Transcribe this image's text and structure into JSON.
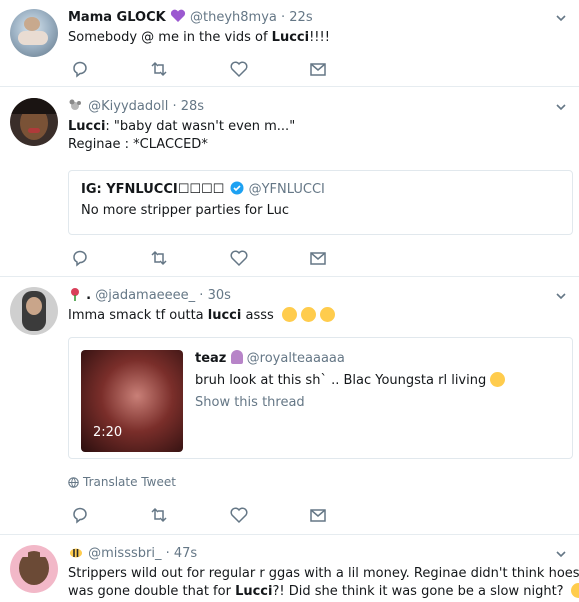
{
  "tweets": [
    {
      "name": "Mama GLOCK",
      "handle": "@theyh8mya",
      "time": "22s",
      "text_before": "Somebody @ me in the vids of ",
      "text_bold": "Lucci",
      "text_after": "!!!!"
    },
    {
      "handle": "@Kiyydadoll",
      "time": "28s",
      "line1_bold": "Lucci",
      "line1_rest": ": \"baby dat wasn't even m...\"",
      "line2": "Reginae : *CLACCED*",
      "quote": {
        "name": "IG: YFNLUCCI☐☐☐☐",
        "handle": "@YFNLUCCI",
        "text": "No more stripper parties for Luc"
      }
    },
    {
      "handle_prefix": ".",
      "handle": "@jadamaeeee_",
      "time": "30s",
      "text_before": "Imma smack tf outta ",
      "text_bold": "lucci",
      "text_after": " asss",
      "quote": {
        "name": "teaz",
        "handle": "@royalteaaaaa",
        "text": "bruh look at this sh` .. Blac Youngsta rl living",
        "show_thread": "Show this thread",
        "duration": "2:20"
      },
      "translate": "Translate Tweet"
    },
    {
      "handle": "@misssbri_",
      "time": "47s",
      "text1": "Strippers wild out for regular r  ggas with a lil money. Reginae didn't think hoes",
      "text2_before": "was gone double that for ",
      "text2_bold": "Lucci",
      "text2_after": "?! Did she think it was gone be a slow night?"
    }
  ],
  "colors": {
    "accent": "#1da1f2",
    "muted": "#657786",
    "purple_heart": "#9b59d0",
    "emoji_yellow": "#ffcc4d"
  },
  "icons": [
    "reply-icon",
    "retweet-icon",
    "like-icon",
    "message-icon",
    "chevron-down-icon",
    "verified-icon",
    "globe-icon"
  ]
}
